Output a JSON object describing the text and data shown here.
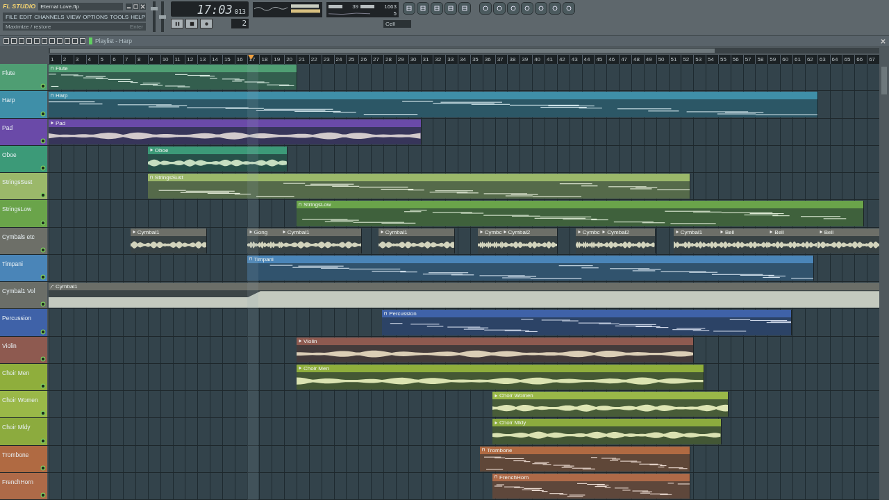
{
  "window": {
    "logo": "FL STUDIO",
    "title": "Eternal Love.flp"
  },
  "menu": [
    "FILE",
    "EDIT",
    "CHANNELS",
    "VIEW",
    "OPTIONS",
    "TOOLS",
    "HELP"
  ],
  "hint": {
    "text": "Maximize / restore",
    "shortcut": "Enter"
  },
  "time": {
    "main": "17:03",
    "sub": "013"
  },
  "pattern": "2",
  "master_volume": {
    "level": 0.8
  },
  "master_pitch": {
    "level": 0.5
  },
  "cpu": {
    "polyphony": "39",
    "memory": "1663",
    "value": "5"
  },
  "snap": "Cell",
  "playlist_title": "Playlist - Harp",
  "ruler": [
    "1",
    "2",
    "3",
    "4",
    "5",
    "6",
    "7",
    "8",
    "9",
    "10",
    "11",
    "12",
    "13",
    "14",
    "15",
    "16",
    "17",
    "18",
    "19",
    "20",
    "21",
    "22",
    "23",
    "24",
    "25",
    "26",
    "27",
    "28",
    "29",
    "30",
    "31",
    "32",
    "33",
    "34",
    "35",
    "36",
    "37",
    "38",
    "39",
    "40",
    "41",
    "42",
    "43",
    "44",
    "45",
    "46",
    "47",
    "48",
    "49",
    "50",
    "51",
    "52",
    "53",
    "54",
    "55",
    "56",
    "57",
    "58",
    "59",
    "60",
    "61",
    "62",
    "63",
    "64",
    "65",
    "66",
    "67"
  ],
  "tracks": [
    {
      "name": "Flute",
      "color": "#4f9e73",
      "clips": [
        {
          "label": "Flute",
          "kind": "pattern"
        }
      ]
    },
    {
      "name": "Harp",
      "color": "#3f8fa8",
      "clips": [
        {
          "label": "Harp",
          "kind": "pattern"
        }
      ]
    },
    {
      "name": "Pad",
      "color": "#6a4aa8",
      "clips": [
        {
          "label": "Pad",
          "kind": "audio"
        }
      ]
    },
    {
      "name": "Oboe",
      "color": "#3c9a78",
      "clips": [
        {
          "label": "Oboe",
          "kind": "audio"
        }
      ]
    },
    {
      "name": "StringsSust",
      "color": "#9bb86a",
      "clips": [
        {
          "label": "StringsSust",
          "kind": "pattern"
        }
      ]
    },
    {
      "name": "StringsLow",
      "color": "#6aa44a",
      "clips": [
        {
          "label": "StringsLow",
          "kind": "pattern"
        }
      ]
    },
    {
      "name": "Cymbals etc",
      "color": "#6d6f68",
      "clips": [
        {
          "label": "Cymbal1",
          "kind": "audio"
        },
        {
          "label": "Gong",
          "kind": "audio"
        },
        {
          "label": "Cymbal1",
          "kind": "audio"
        },
        {
          "label": "Cymbal1",
          "kind": "audio"
        },
        {
          "label": "Cymbc",
          "kind": "audio"
        },
        {
          "label": "Cymbal2",
          "kind": "audio"
        },
        {
          "label": "Cymbc",
          "kind": "audio"
        },
        {
          "label": "Cymbal2",
          "kind": "audio"
        },
        {
          "label": "Cymbal1",
          "kind": "audio"
        },
        {
          "label": "Bell",
          "kind": "audio"
        },
        {
          "label": "Bell",
          "kind": "audio"
        },
        {
          "label": "Bell",
          "kind": "audio"
        }
      ]
    },
    {
      "name": "Timpani",
      "color": "#4a85b8",
      "clips": [
        {
          "label": "Timpani",
          "kind": "pattern"
        }
      ]
    },
    {
      "name": "Cymbal1 Vol",
      "color": "#6b6e68",
      "clips": [
        {
          "label": "Cymbal1",
          "kind": "automation"
        }
      ]
    },
    {
      "name": "Percussion",
      "color": "#3f62a8",
      "clips": [
        {
          "label": "Percussion",
          "kind": "pattern"
        }
      ]
    },
    {
      "name": "Violin",
      "color": "#8e5a50",
      "clips": [
        {
          "label": "Violin",
          "kind": "audio"
        }
      ]
    },
    {
      "name": "Choir Men",
      "color": "#8fae3c",
      "clips": [
        {
          "label": "Choir Men",
          "kind": "audio"
        }
      ]
    },
    {
      "name": "Choir Women",
      "color": "#9ab848",
      "clips": [
        {
          "label": "Choir Women",
          "kind": "audio"
        }
      ]
    },
    {
      "name": "Choir Mldy",
      "color": "#8cab3e",
      "clips": [
        {
          "label": "Choir Mldy",
          "kind": "audio"
        }
      ]
    },
    {
      "name": "Trombone",
      "color": "#b06a42",
      "clips": [
        {
          "label": "Trombone",
          "kind": "pattern"
        }
      ]
    },
    {
      "name": "FrenchHorn",
      "color": "#ae6a48",
      "clips": [
        {
          "label": "FrenchHorn",
          "kind": "pattern"
        }
      ]
    }
  ]
}
